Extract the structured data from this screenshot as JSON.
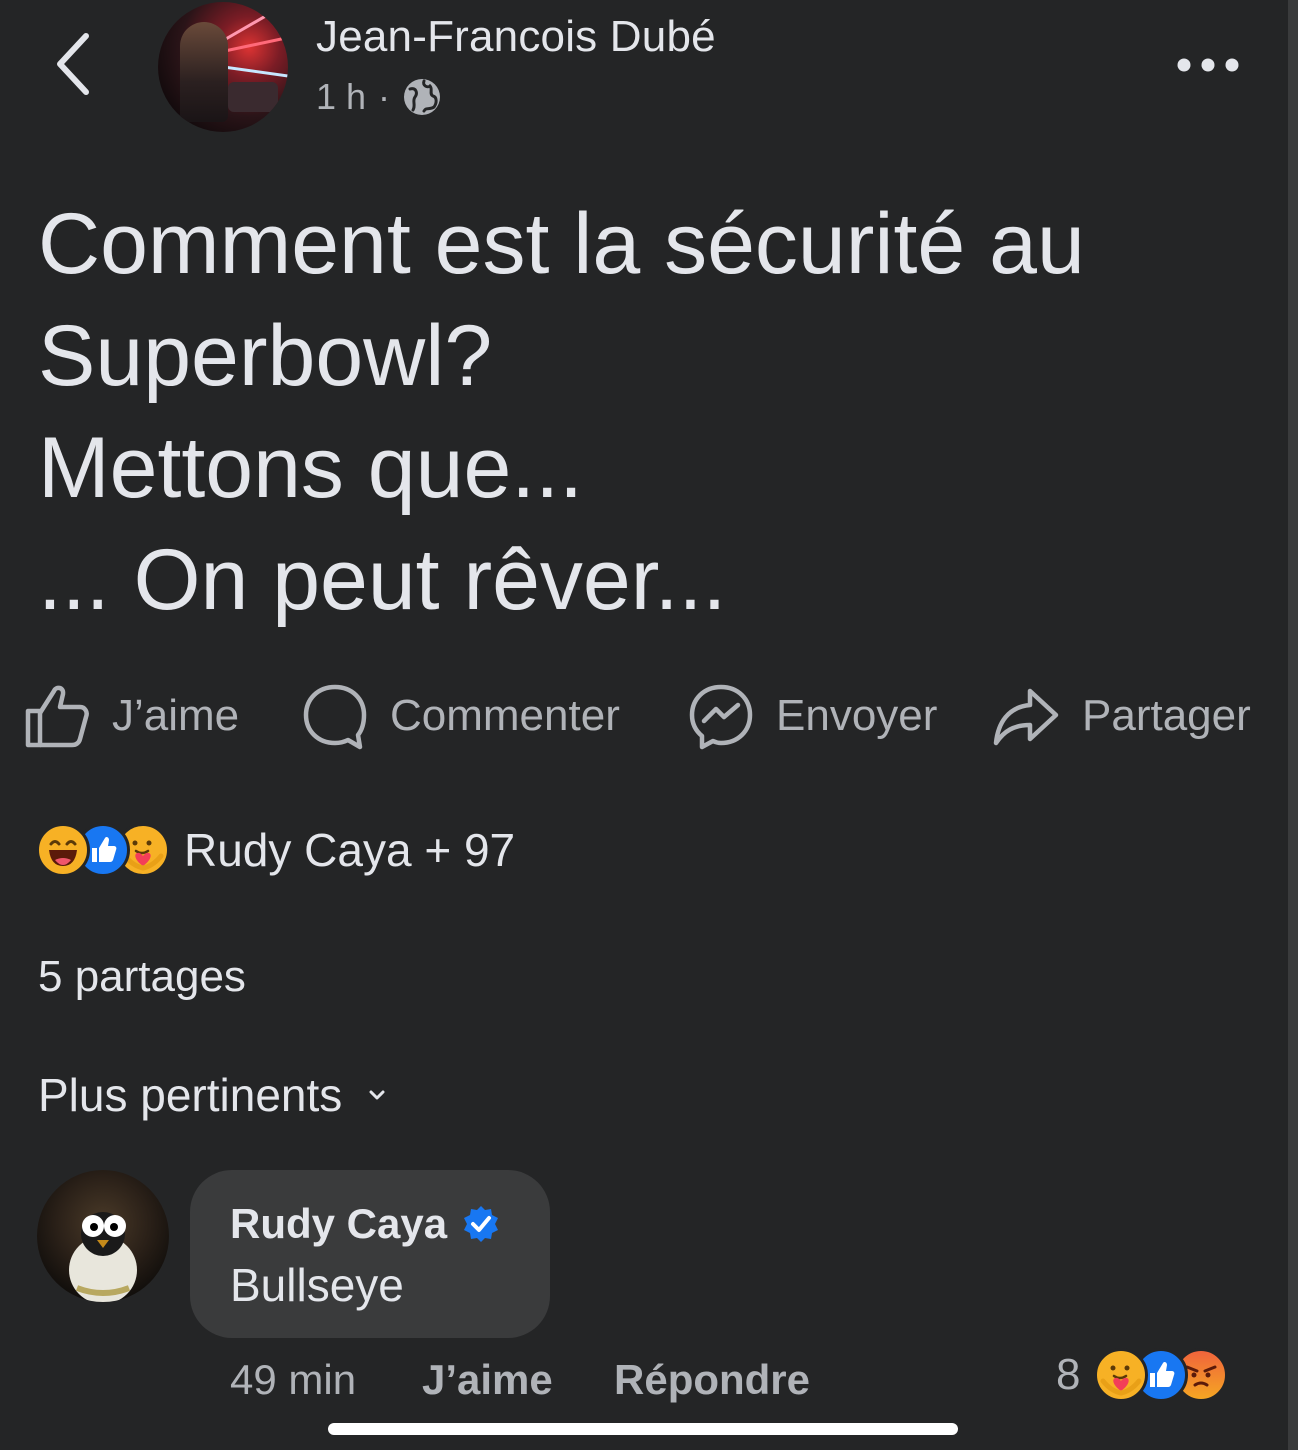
{
  "header": {
    "author_name": "Jean-Francois Dubé",
    "time": "1 h",
    "separator": "·",
    "privacy_icon": "globe-icon"
  },
  "post": {
    "lines": [
      "Comment est la sécurité au",
      "Superbowl?",
      "Mettons que...",
      "... On peut rêver..."
    ]
  },
  "actions": {
    "like": "J’aime",
    "comment": "Commenter",
    "send": "Envoyer",
    "share": "Partager"
  },
  "reactions": {
    "icons": [
      "laugh-emoji-icon",
      "like-reaction-icon",
      "care-emoji-icon"
    ],
    "summary": "Rudy Caya + 97"
  },
  "shares": "5 partages",
  "sort": {
    "label": "Plus pertinents"
  },
  "comment": {
    "author": "Rudy Caya",
    "verified": true,
    "text": "Bullseye",
    "time": "49 min",
    "like": "J’aime",
    "reply": "Répondre",
    "reaction_count": "8",
    "reaction_icons": [
      "care-emoji-icon",
      "like-reaction-icon",
      "angry-emoji-icon"
    ]
  },
  "colors": {
    "background": "#242526",
    "bubble": "#3a3b3c",
    "text_primary": "#e4e6eb",
    "text_secondary": "#b0b3b8",
    "like_blue": "#1877f2"
  }
}
